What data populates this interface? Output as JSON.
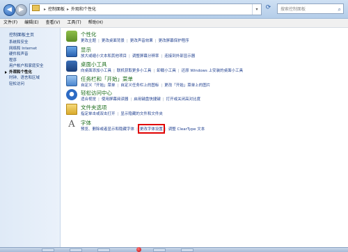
{
  "address_bar": {
    "crumbs": [
      "控制面板",
      "外观和个性化"
    ],
    "search_placeholder": "搜索控制面板"
  },
  "menu": [
    "文件(F)",
    "编辑(E)",
    "查看(V)",
    "工具(T)",
    "帮助(H)"
  ],
  "sidebar": {
    "home": "控制面板主页",
    "items": [
      {
        "label": "系统和安全",
        "active": false
      },
      {
        "label": "网络和 Internet",
        "active": false
      },
      {
        "label": "硬件和声音",
        "active": false
      },
      {
        "label": "程序",
        "active": false
      },
      {
        "label": "用户帐户和家庭安全",
        "active": false
      },
      {
        "label": "外观和个性化",
        "active": true
      },
      {
        "label": "时钟、语言和区域",
        "active": false
      },
      {
        "label": "轻松访问",
        "active": false
      }
    ]
  },
  "categories": [
    {
      "icon": "personalization-icon",
      "title": "个性化",
      "links": [
        "更改主题",
        "更改桌面背景",
        "更改声音效果",
        "更改屏幕保护程序"
      ]
    },
    {
      "icon": "display-icon",
      "title": "显示",
      "links": [
        "放大或缩小文本和其他项目",
        "调整屏幕分辨率",
        "连接到外部显示器"
      ]
    },
    {
      "icon": "gadgets-icon",
      "title": "桌面小工具",
      "links": [
        "向桌面添加小工具",
        "联机获取更多小工具",
        "卸载小工具",
        "还原 Windows 上安装的桌面小工具"
      ]
    },
    {
      "icon": "taskbar-icon",
      "title": "任务栏和「开始」菜单",
      "links": [
        "自定义「开始」菜单",
        "自定义任务栏上的图标",
        "更改「开始」菜单上的图片"
      ]
    },
    {
      "icon": "ease-of-access-icon",
      "title": "轻松访问中心",
      "links": [
        "适合视觉",
        "使用屏幕阅读器",
        "启用键盘快捷键",
        "打开或关闭高对比度"
      ]
    },
    {
      "icon": "folder-options-icon",
      "title": "文件夹选项",
      "links": [
        "指定单击或双击打开",
        "显示隐藏的文件和文件夹"
      ]
    },
    {
      "icon": "fonts-icon",
      "title": "字体",
      "links": [
        "预览、删除或者显示和隐藏字体",
        "更改字体设置",
        "调整 ClearType 文本"
      ]
    }
  ],
  "highlighted_link": "更改字体设置",
  "colors": {
    "highlight_box": "#e00000",
    "title_green": "#1d6e1d",
    "link_blue": "#1f3f8f"
  }
}
